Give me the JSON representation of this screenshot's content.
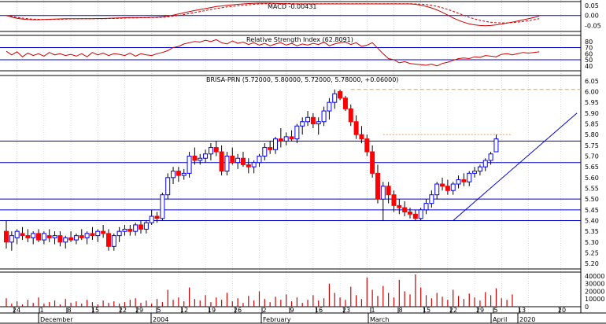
{
  "chart_data": {
    "type": "candlestick",
    "colors": {
      "up_candle": "#0000ff",
      "down_candle": "#ff0000",
      "h_lines": "#0000cc",
      "trendline": "#0000cc",
      "dashed_levels": "#ff9933",
      "macd_line": "#cc0000",
      "volume_bars": "#cc0000",
      "grid": "#bbbbbb"
    },
    "macd_panel": {
      "title": "MACD -0.00431",
      "yticks": [
        "0.05",
        "0.00",
        "-0.05"
      ],
      "ylim": [
        -0.08,
        0.07
      ],
      "zero_line": 0.0,
      "macd": [
        0.0,
        -0.008,
        -0.014,
        -0.018,
        -0.02,
        -0.021,
        -0.021,
        -0.02,
        -0.019,
        -0.018,
        -0.017,
        -0.016,
        -0.016,
        -0.016,
        -0.016,
        -0.016,
        -0.016,
        -0.015,
        -0.015,
        -0.014,
        -0.013,
        -0.012,
        -0.011,
        -0.01,
        -0.01,
        -0.01,
        -0.01,
        -0.009,
        -0.008,
        -0.006,
        -0.003,
        0.002,
        0.008,
        0.014,
        0.02,
        0.025,
        0.03,
        0.035,
        0.04,
        0.045,
        0.048,
        0.051,
        0.054,
        0.056,
        0.058,
        0.06,
        0.061,
        0.062,
        0.062,
        0.062,
        0.061,
        0.06,
        0.059,
        0.058,
        0.058,
        0.058,
        0.058,
        0.058,
        0.058,
        0.058,
        0.058,
        0.058,
        0.058,
        0.058,
        0.058,
        0.058,
        0.058,
        0.058,
        0.058,
        0.058,
        0.058,
        0.058,
        0.058,
        0.058,
        0.058,
        0.058,
        0.056,
        0.052,
        0.046,
        0.038,
        0.028,
        0.016,
        0.002,
        -0.012,
        -0.024,
        -0.034,
        -0.042,
        -0.047,
        -0.05,
        -0.051,
        -0.05,
        -0.047,
        -0.043,
        -0.038,
        -0.033,
        -0.028,
        -0.022,
        -0.016,
        -0.01,
        -0.004
      ],
      "signal": [
        0.0,
        -0.004,
        -0.009,
        -0.013,
        -0.016,
        -0.018,
        -0.019,
        -0.02,
        -0.02,
        -0.019,
        -0.019,
        -0.018,
        -0.017,
        -0.017,
        -0.016,
        -0.016,
        -0.016,
        -0.016,
        -0.016,
        -0.015,
        -0.015,
        -0.014,
        -0.013,
        -0.012,
        -0.012,
        -0.011,
        -0.011,
        -0.01,
        -0.01,
        -0.009,
        -0.007,
        -0.004,
        0.0,
        0.005,
        0.01,
        0.015,
        0.02,
        0.025,
        0.03,
        0.035,
        0.039,
        0.043,
        0.046,
        0.049,
        0.052,
        0.054,
        0.056,
        0.058,
        0.059,
        0.06,
        0.06,
        0.06,
        0.06,
        0.06,
        0.059,
        0.059,
        0.059,
        0.059,
        0.059,
        0.059,
        0.059,
        0.059,
        0.059,
        0.059,
        0.059,
        0.059,
        0.059,
        0.059,
        0.059,
        0.059,
        0.059,
        0.059,
        0.059,
        0.059,
        0.059,
        0.059,
        0.058,
        0.057,
        0.055,
        0.051,
        0.046,
        0.039,
        0.031,
        0.021,
        0.011,
        0.001,
        -0.009,
        -0.017,
        -0.024,
        -0.03,
        -0.034,
        -0.036,
        -0.037,
        -0.037,
        -0.035,
        -0.033,
        -0.03,
        -0.026,
        -0.021,
        -0.016
      ]
    },
    "rsi_panel": {
      "title": "Relative Strength Index (62.8091)",
      "yticks": [
        "80",
        "70",
        "60",
        "50",
        "40"
      ],
      "ylim": [
        32,
        90
      ],
      "levels": [
        70,
        50
      ],
      "rsi": [
        64,
        58,
        63,
        55,
        61,
        57,
        60,
        56,
        62,
        58,
        60,
        57,
        59,
        56,
        60,
        55,
        62,
        58,
        61,
        57,
        60,
        59,
        57,
        61,
        56,
        60,
        58,
        57,
        60,
        62,
        65,
        70,
        72,
        76,
        78,
        80,
        79,
        82,
        80,
        83,
        78,
        76,
        81,
        77,
        79,
        75,
        78,
        74,
        77,
        73,
        76,
        78,
        74,
        77,
        73,
        76,
        74,
        77,
        75,
        79,
        73,
        76,
        78,
        79,
        75,
        78,
        72,
        74,
        78,
        69,
        60,
        52,
        50,
        45,
        47,
        44,
        43,
        42,
        41,
        43,
        40,
        44,
        46,
        49,
        52,
        53,
        52,
        55,
        54,
        57,
        56,
        55,
        59,
        60,
        58,
        60,
        62,
        61,
        62,
        63
      ]
    },
    "price_panel": {
      "title": "BRISA-PRN (5.72000, 5.80000, 5.72000, 5.78000, +0.06000)",
      "yticks": [
        "6.05",
        "6.00",
        "5.95",
        "5.90",
        "5.85",
        "5.80",
        "5.75",
        "5.70",
        "5.65",
        "5.60",
        "5.55",
        "5.50",
        "5.45",
        "5.40",
        "5.35",
        "5.30",
        "5.25",
        "5.20"
      ],
      "ylim": [
        5.175,
        6.075
      ],
      "h_levels": [
        5.77,
        5.67,
        5.5,
        5.45,
        5.4
      ],
      "dashed_levels": [
        6.01,
        5.8
      ],
      "trendline": {
        "from": {
          "x": "Mar 22",
          "y": 5.4
        },
        "to": {
          "x": "Apr 21",
          "y": 5.9
        }
      },
      "ohlc": [
        [
          5.35,
          5.4,
          5.27,
          5.3
        ],
        [
          5.3,
          5.35,
          5.26,
          5.33
        ],
        [
          5.32,
          5.36,
          5.29,
          5.35
        ],
        [
          5.34,
          5.37,
          5.31,
          5.33
        ],
        [
          5.33,
          5.36,
          5.3,
          5.32
        ],
        [
          5.32,
          5.35,
          5.29,
          5.34
        ],
        [
          5.34,
          5.36,
          5.3,
          5.31
        ],
        [
          5.31,
          5.35,
          5.29,
          5.34
        ],
        [
          5.33,
          5.36,
          5.3,
          5.32
        ],
        [
          5.32,
          5.35,
          5.29,
          5.33
        ],
        [
          5.33,
          5.35,
          5.28,
          5.3
        ],
        [
          5.3,
          5.33,
          5.27,
          5.32
        ],
        [
          5.32,
          5.35,
          5.3,
          5.31
        ],
        [
          5.31,
          5.34,
          5.29,
          5.33
        ],
        [
          5.33,
          5.36,
          5.31,
          5.32
        ],
        [
          5.32,
          5.35,
          5.29,
          5.34
        ],
        [
          5.34,
          5.37,
          5.31,
          5.33
        ],
        [
          5.33,
          5.36,
          5.3,
          5.35
        ],
        [
          5.35,
          5.38,
          5.32,
          5.34
        ],
        [
          5.34,
          5.36,
          5.26,
          5.28
        ],
        [
          5.28,
          5.34,
          5.26,
          5.33
        ],
        [
          5.33,
          5.37,
          5.3,
          5.35
        ],
        [
          5.35,
          5.38,
          5.33,
          5.36
        ],
        [
          5.36,
          5.38,
          5.33,
          5.35
        ],
        [
          5.35,
          5.39,
          5.33,
          5.38
        ],
        [
          5.38,
          5.4,
          5.34,
          5.36
        ],
        [
          5.36,
          5.4,
          5.34,
          5.39
        ],
        [
          5.39,
          5.45,
          5.38,
          5.42
        ],
        [
          5.42,
          5.44,
          5.39,
          5.41
        ],
        [
          5.41,
          5.53,
          5.4,
          5.52
        ],
        [
          5.52,
          5.62,
          5.5,
          5.6
        ],
        [
          5.6,
          5.65,
          5.57,
          5.63
        ],
        [
          5.63,
          5.65,
          5.58,
          5.61
        ],
        [
          5.61,
          5.64,
          5.59,
          5.62
        ],
        [
          5.62,
          5.72,
          5.6,
          5.7
        ],
        [
          5.7,
          5.74,
          5.66,
          5.68
        ],
        [
          5.68,
          5.71,
          5.66,
          5.69
        ],
        [
          5.69,
          5.73,
          5.67,
          5.71
        ],
        [
          5.71,
          5.76,
          5.68,
          5.74
        ],
        [
          5.74,
          5.77,
          5.7,
          5.72
        ],
        [
          5.72,
          5.75,
          5.61,
          5.63
        ],
        [
          5.63,
          5.72,
          5.61,
          5.7
        ],
        [
          5.7,
          5.74,
          5.66,
          5.67
        ],
        [
          5.67,
          5.71,
          5.64,
          5.69
        ],
        [
          5.69,
          5.72,
          5.65,
          5.66
        ],
        [
          5.66,
          5.69,
          5.62,
          5.65
        ],
        [
          5.65,
          5.68,
          5.62,
          5.67
        ],
        [
          5.67,
          5.71,
          5.65,
          5.7
        ],
        [
          5.7,
          5.76,
          5.68,
          5.74
        ],
        [
          5.74,
          5.77,
          5.71,
          5.73
        ],
        [
          5.73,
          5.79,
          5.71,
          5.78
        ],
        [
          5.78,
          5.83,
          5.74,
          5.77
        ],
        [
          5.77,
          5.81,
          5.75,
          5.79
        ],
        [
          5.79,
          5.82,
          5.77,
          5.78
        ],
        [
          5.78,
          5.85,
          5.76,
          5.84
        ],
        [
          5.84,
          5.88,
          5.8,
          5.86
        ],
        [
          5.86,
          5.91,
          5.84,
          5.88
        ],
        [
          5.88,
          5.9,
          5.83,
          5.85
        ],
        [
          5.85,
          5.88,
          5.8,
          5.86
        ],
        [
          5.86,
          5.93,
          5.84,
          5.91
        ],
        [
          5.91,
          5.97,
          5.87,
          5.95
        ],
        [
          5.95,
          6.01,
          5.92,
          5.99
        ],
        [
          6.0,
          6.01,
          5.96,
          5.97
        ],
        [
          5.97,
          5.98,
          5.91,
          5.92
        ],
        [
          5.92,
          5.94,
          5.84,
          5.86
        ],
        [
          5.86,
          5.89,
          5.78,
          5.8
        ],
        [
          5.8,
          5.84,
          5.76,
          5.78
        ],
        [
          5.78,
          5.8,
          5.7,
          5.72
        ],
        [
          5.72,
          5.75,
          5.6,
          5.62
        ],
        [
          5.62,
          5.66,
          5.48,
          5.5
        ],
        [
          5.5,
          5.58,
          5.4,
          5.56
        ],
        [
          5.56,
          5.58,
          5.48,
          5.52
        ],
        [
          5.52,
          5.54,
          5.44,
          5.47
        ],
        [
          5.47,
          5.5,
          5.43,
          5.46
        ],
        [
          5.46,
          5.49,
          5.42,
          5.44
        ],
        [
          5.44,
          5.46,
          5.41,
          5.43
        ],
        [
          5.43,
          5.45,
          5.4,
          5.41
        ],
        [
          5.41,
          5.46,
          5.4,
          5.45
        ],
        [
          5.45,
          5.5,
          5.43,
          5.48
        ],
        [
          5.48,
          5.54,
          5.46,
          5.52
        ],
        [
          5.52,
          5.58,
          5.5,
          5.57
        ],
        [
          5.57,
          5.6,
          5.54,
          5.56
        ],
        [
          5.56,
          5.59,
          5.52,
          5.54
        ],
        [
          5.54,
          5.58,
          5.52,
          5.57
        ],
        [
          5.57,
          5.61,
          5.55,
          5.59
        ],
        [
          5.59,
          5.62,
          5.56,
          5.58
        ],
        [
          5.58,
          5.63,
          5.56,
          5.62
        ],
        [
          5.62,
          5.65,
          5.6,
          5.63
        ],
        [
          5.63,
          5.66,
          5.61,
          5.65
        ],
        [
          5.65,
          5.69,
          5.63,
          5.68
        ],
        [
          5.68,
          5.72,
          5.66,
          5.71
        ],
        [
          5.72,
          5.8,
          5.72,
          5.78
        ]
      ]
    },
    "volume_panel": {
      "yticks": [
        "40000",
        "30000",
        "20000",
        "10000",
        "0"
      ],
      "ylim": [
        0,
        45000
      ],
      "volume": [
        11000,
        4000,
        7000,
        3000,
        9000,
        5000,
        12000,
        4000,
        6000,
        8000,
        3000,
        10000,
        5000,
        7000,
        4000,
        9000,
        6000,
        3000,
        8000,
        5000,
        7000,
        4000,
        6000,
        9000,
        11000,
        5000,
        8000,
        4000,
        10000,
        6000,
        22000,
        9000,
        12000,
        7000,
        25000,
        10000,
        8000,
        15000,
        6000,
        12000,
        9000,
        18000,
        7000,
        11000,
        5000,
        14000,
        8000,
        20000,
        10000,
        6000,
        13000,
        9000,
        16000,
        7000,
        12000,
        5000,
        9000,
        15000,
        8000,
        11000,
        30000,
        18000,
        12000,
        9000,
        26000,
        15000,
        10000,
        38000,
        22000,
        14000,
        27000,
        18000,
        12000,
        35000,
        20000,
        16000,
        42000,
        25000,
        15000,
        11000,
        18000,
        13000,
        9000,
        22000,
        14000,
        10000,
        17000,
        12000,
        8000,
        19000,
        15000,
        24000,
        11000,
        9000,
        16000
      ]
    },
    "x_axis": {
      "day_labels": [
        "24",
        "1",
        "8",
        "15",
        "22",
        "29",
        "5",
        "12",
        "19",
        "26",
        "2",
        "9",
        "16",
        "23",
        "1",
        "8",
        "15",
        "22",
        "29",
        "5",
        "13",
        "20"
      ],
      "month_labels": [
        "December",
        "2004",
        "February",
        "March",
        "April",
        "2020"
      ]
    }
  }
}
